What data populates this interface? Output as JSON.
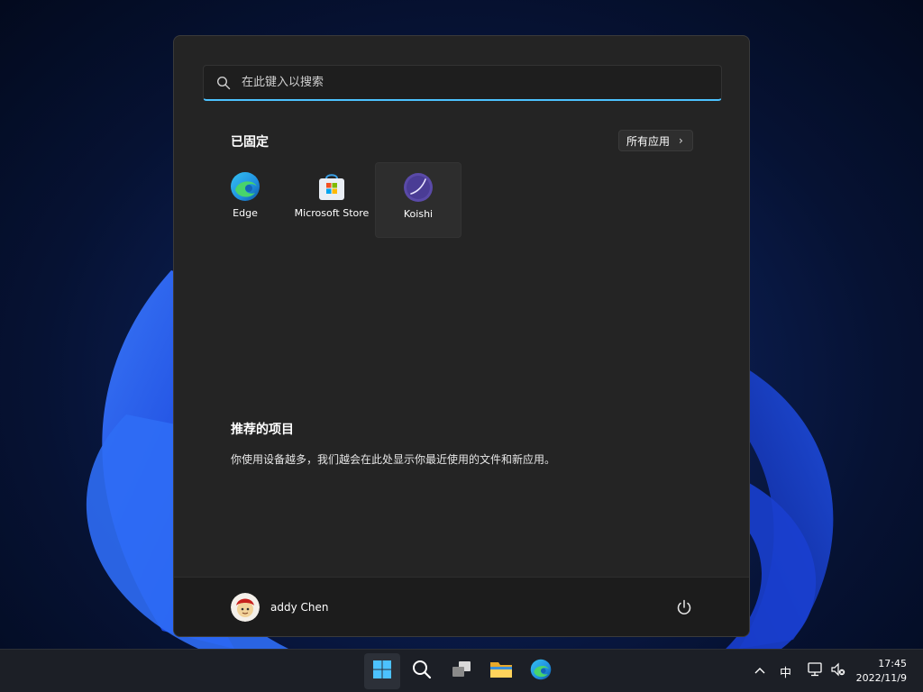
{
  "start_menu": {
    "search": {
      "placeholder": "在此键入以搜索"
    },
    "pinned": {
      "title": "已固定",
      "all_apps_label": "所有应用",
      "apps": [
        {
          "label": "Edge",
          "icon": "edge-icon"
        },
        {
          "label": "Microsoft Store",
          "icon": "store-icon"
        },
        {
          "label": "Koishi",
          "icon": "koishi-icon"
        }
      ]
    },
    "recommended": {
      "title": "推荐的项目",
      "text": "你使用设备越多，我们越会在此处显示你最近使用的文件和新应用。"
    },
    "user": {
      "name": "addy Chen",
      "avatar_icon": "user-avatar"
    },
    "power_icon": "power-icon"
  },
  "taskbar": {
    "icons": [
      "start-icon",
      "search-icon",
      "task-view-icon",
      "file-explorer-icon",
      "edge-icon"
    ],
    "tray": {
      "chevron": "^",
      "ime": "中",
      "network_icon": "network-icon",
      "volume_icon": "volume-muted-icon"
    },
    "clock": {
      "time": "17:45",
      "date": "2022/11/9"
    }
  },
  "colors": {
    "accent": "#4cc2ff",
    "menu_bg": "#242424",
    "koishi": "#5a4aa8"
  }
}
